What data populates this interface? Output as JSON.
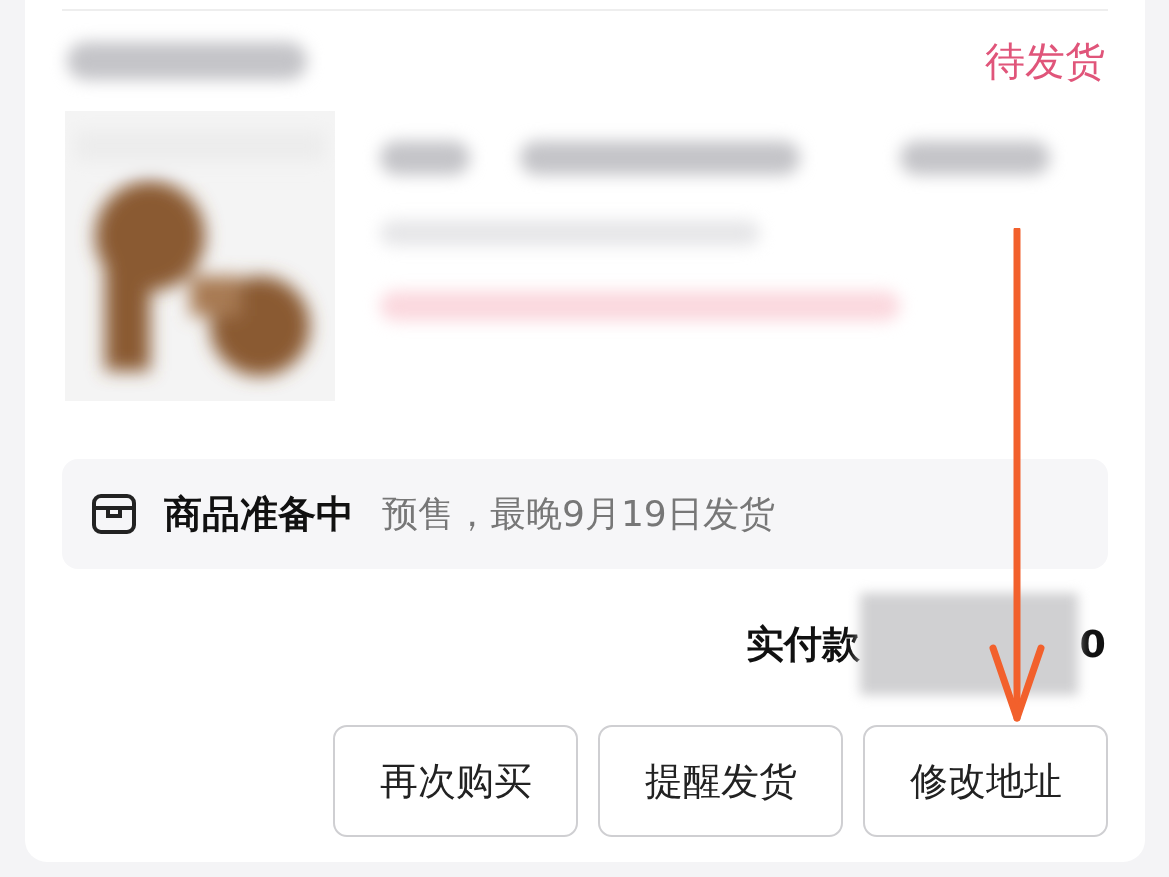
{
  "order": {
    "status": "待发货",
    "notice": {
      "title": "商品准备中",
      "text": "预售，最晚9月19日发货"
    },
    "payment": {
      "label": "实付款",
      "amount": "0"
    },
    "buttons": [
      {
        "label": "再次购买"
      },
      {
        "label": "提醒发货"
      },
      {
        "label": "修改地址"
      }
    ]
  }
}
